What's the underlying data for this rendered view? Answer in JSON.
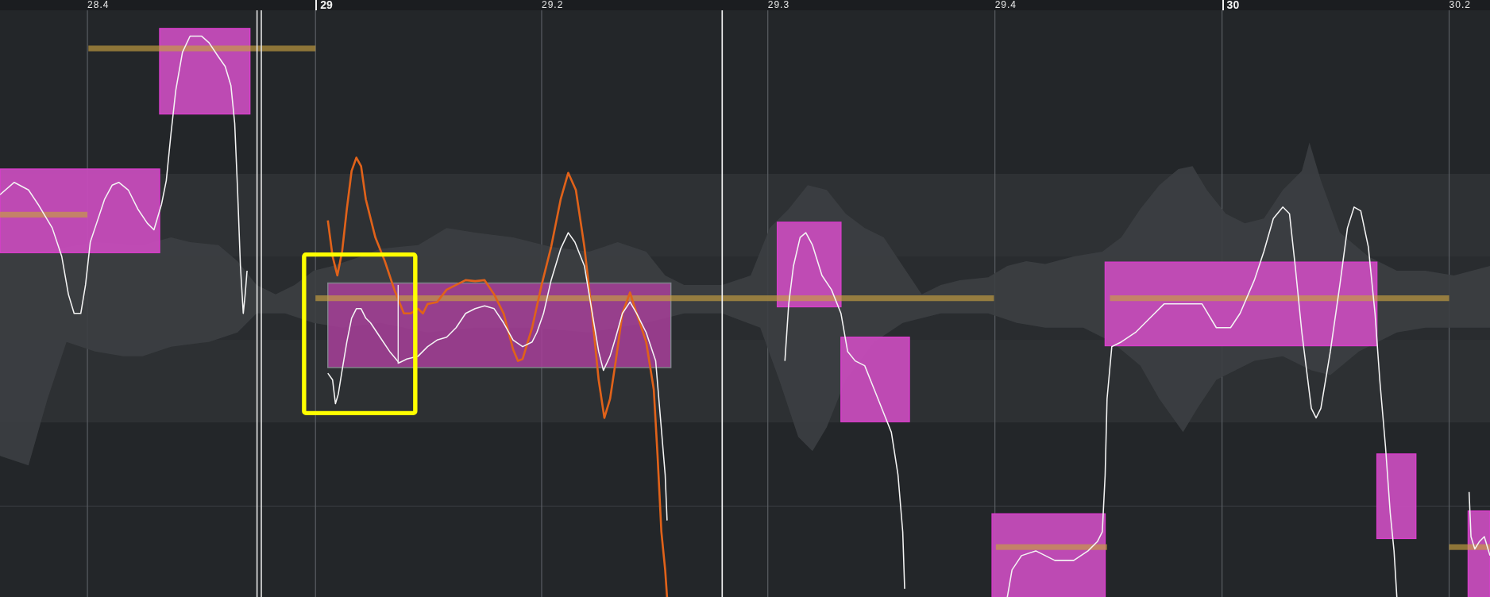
{
  "ruler": {
    "marks": [
      {
        "label": "28.4",
        "kind": "beat"
      },
      {
        "label": "29",
        "kind": "bar"
      },
      {
        "label": "29.2",
        "kind": "beat"
      },
      {
        "label": "29.3",
        "kind": "beat"
      },
      {
        "label": "29.4",
        "kind": "beat"
      },
      {
        "label": "30",
        "kind": "bar"
      },
      {
        "label": "30.2",
        "kind": "beat"
      }
    ]
  },
  "segments": [
    {
      "selected": false
    },
    {
      "selected": false
    },
    {
      "selected": true
    },
    {
      "selected": false
    },
    {
      "selected": false
    },
    {
      "selected": false
    },
    {
      "selected": false
    },
    {
      "selected": false
    },
    {
      "selected": false
    }
  ]
}
